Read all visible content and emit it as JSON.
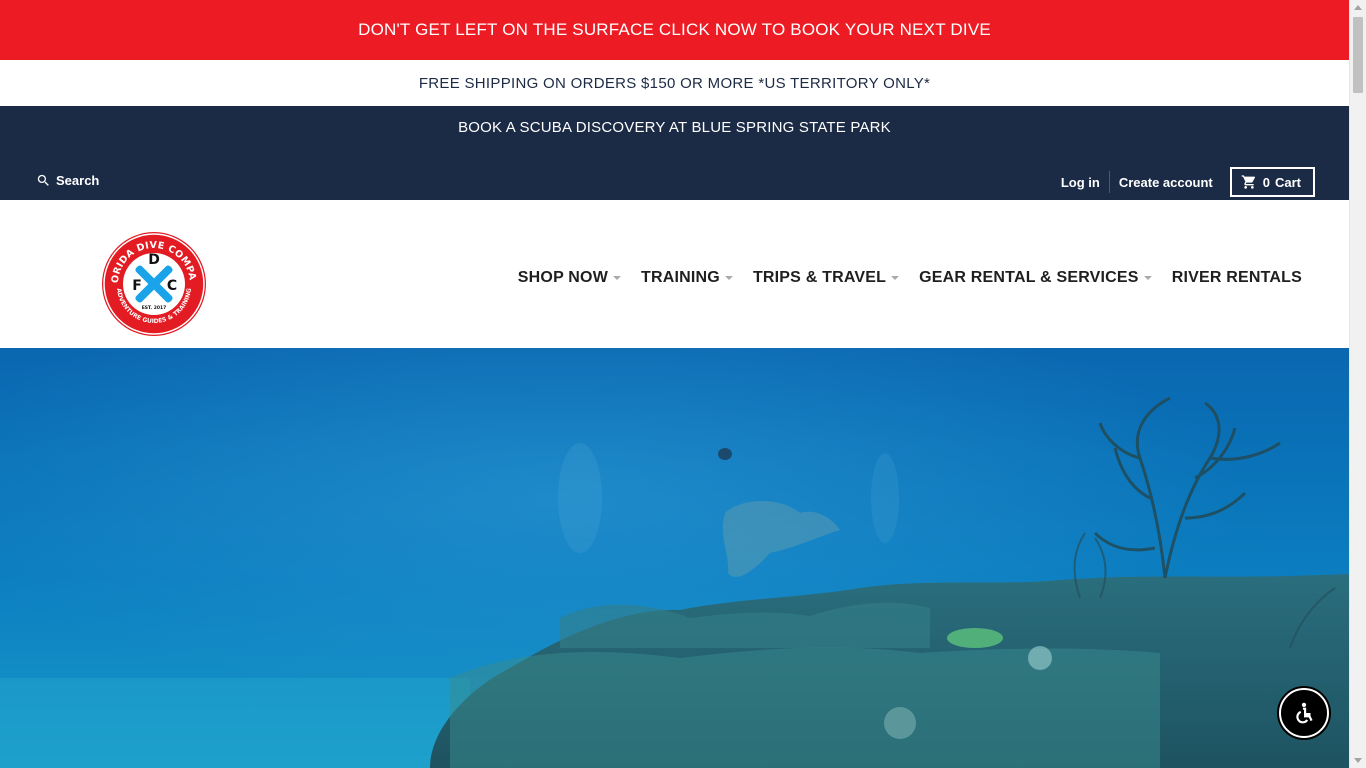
{
  "promo_bar": {
    "text": "DON'T GET LEFT ON THE SURFACE CLICK NOW TO BOOK YOUR NEXT DIVE",
    "color": "#ed1c24"
  },
  "shipping_bar": {
    "text": "FREE SHIPPING ON ORDERS $150 OR MORE *US TERRITORY ONLY*"
  },
  "announcement": {
    "text": "BOOK A SCUBA DISCOVERY AT BLUE SPRING STATE PARK",
    "color": "#1b2a45"
  },
  "utility": {
    "search_label": "Search",
    "search_icon": "search-icon",
    "login_label": "Log in",
    "create_account_label": "Create account",
    "cart_count": "0",
    "cart_label": "Cart",
    "cart_icon": "shopping-cart-icon"
  },
  "logo": {
    "top_text": "FLORIDA DIVE COMPANY",
    "bottom_text": "ADVENTURE GUIDES & TRAINING",
    "letters": [
      "D",
      "F",
      "C"
    ],
    "est": "EST. 2017"
  },
  "nav": {
    "items": [
      {
        "label": "SHOP NOW",
        "has_dropdown": true
      },
      {
        "label": "TRAINING",
        "has_dropdown": true
      },
      {
        "label": "TRIPS & TRAVEL",
        "has_dropdown": true
      },
      {
        "label": "GEAR RENTAL & SERVICES",
        "has_dropdown": true
      },
      {
        "label": "RIVER RENTALS",
        "has_dropdown": false
      }
    ]
  },
  "hero": {
    "scene": "underwater-reef-image",
    "water_color": "#0b7ec0"
  },
  "accessibility_button": {
    "icon": "accessibility-icon"
  }
}
